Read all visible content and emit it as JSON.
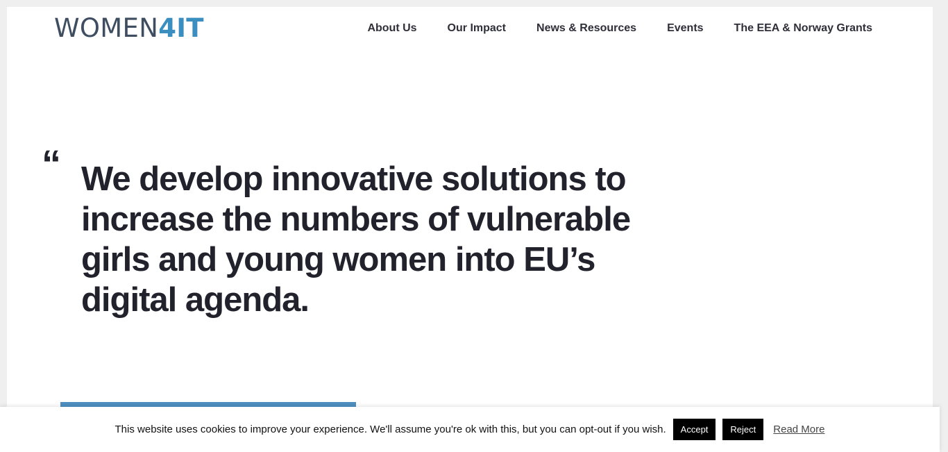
{
  "logo": {
    "part1": "WOMEN",
    "part2": "4IT"
  },
  "nav": {
    "items": [
      "About Us",
      "Our Impact",
      "News & Resources",
      "Events",
      "The EEA & Norway Grants"
    ]
  },
  "hero": {
    "quote_mark": "“",
    "headline": "We develop innovative solutions to increase the numbers of vulnerable girls and young women into EU’s digital agenda."
  },
  "cookie_banner": {
    "message": "This website uses cookies to improve your experience. We'll assume you're ok with this, but you can opt-out if you wish.",
    "accept_label": "Accept",
    "reject_label": "Reject",
    "read_more_label": "Read More"
  },
  "colors": {
    "logo_dark": "#3f4d61",
    "logo_accent": "#3a8fc0",
    "headline": "#22222c",
    "accent_bar": "#4d8fbf"
  }
}
